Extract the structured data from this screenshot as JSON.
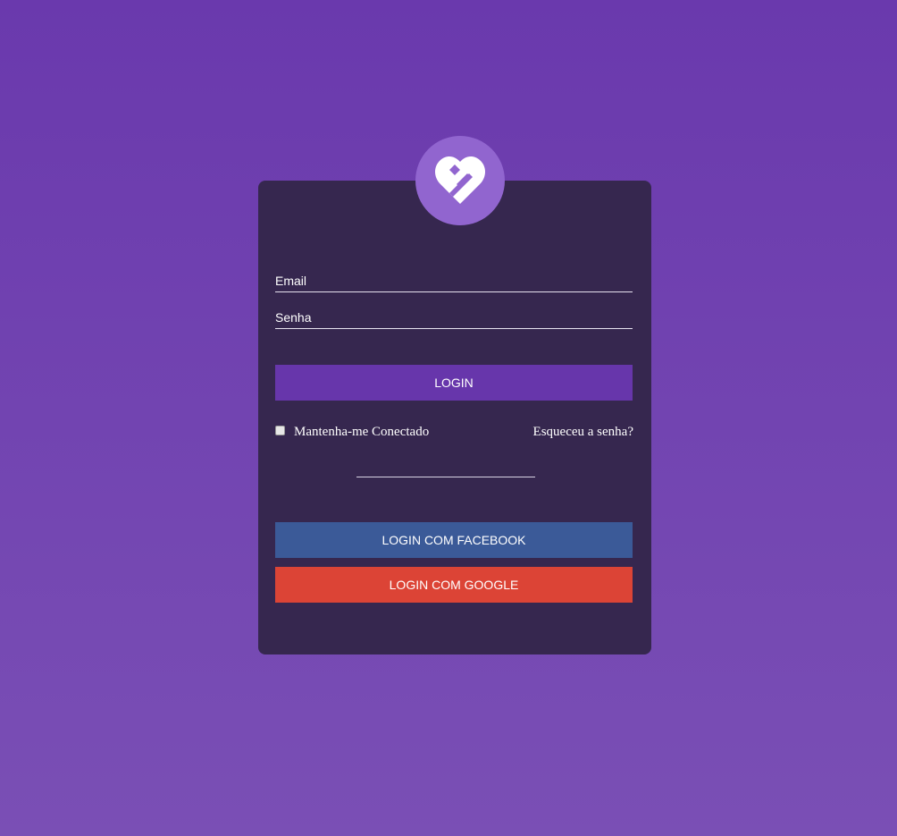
{
  "logo": {
    "icon": "heart-logo-icon",
    "color": "#9165cf"
  },
  "form": {
    "email_placeholder": "Email",
    "password_placeholder": "Senha",
    "login_label": "LOGIN",
    "remember_label": "Mantenha-me Conectado",
    "remember_checked": false,
    "forgot_label": "Esqueceu a senha?",
    "facebook_label": "LOGIN COM FACEBOOK",
    "google_label": "LOGIN COM GOOGLE"
  },
  "colors": {
    "background": "#6a39ad",
    "card": "#36274f",
    "login_button": "#6736ab",
    "facebook_button": "#3b5a98",
    "google_button": "#dc4436"
  }
}
